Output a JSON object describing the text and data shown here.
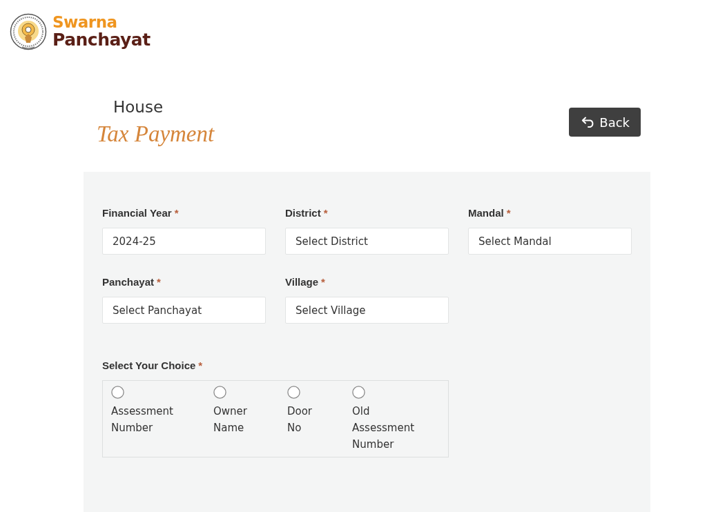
{
  "logo": {
    "line_1": "Swarna",
    "line_2": "Panchayat"
  },
  "page_title": {
    "line_1": "House",
    "line_2": "Tax Payment"
  },
  "back_button": {
    "label": "Back"
  },
  "form": {
    "fields": [
      {
        "label": "Financial Year",
        "required_mark": "*",
        "value": "2024-25"
      },
      {
        "label": "District",
        "required_mark": "*",
        "placeholder": "Select District"
      },
      {
        "label": "Mandal",
        "required_mark": "*",
        "placeholder": "Select Mandal"
      },
      {
        "label": "Panchayat",
        "required_mark": "*",
        "placeholder": "Select Panchayat"
      },
      {
        "label": "Village",
        "required_mark": "*",
        "placeholder": "Select Village"
      }
    ],
    "choice": {
      "label": "Select Your Choice",
      "required_mark": "*",
      "options": [
        {
          "label": "Assessment Number",
          "selected": false
        },
        {
          "label": "Owner Name",
          "selected": false
        },
        {
          "label": "Door No",
          "selected": false
        },
        {
          "label": "Old Assessment Number",
          "selected": false
        }
      ]
    }
  }
}
